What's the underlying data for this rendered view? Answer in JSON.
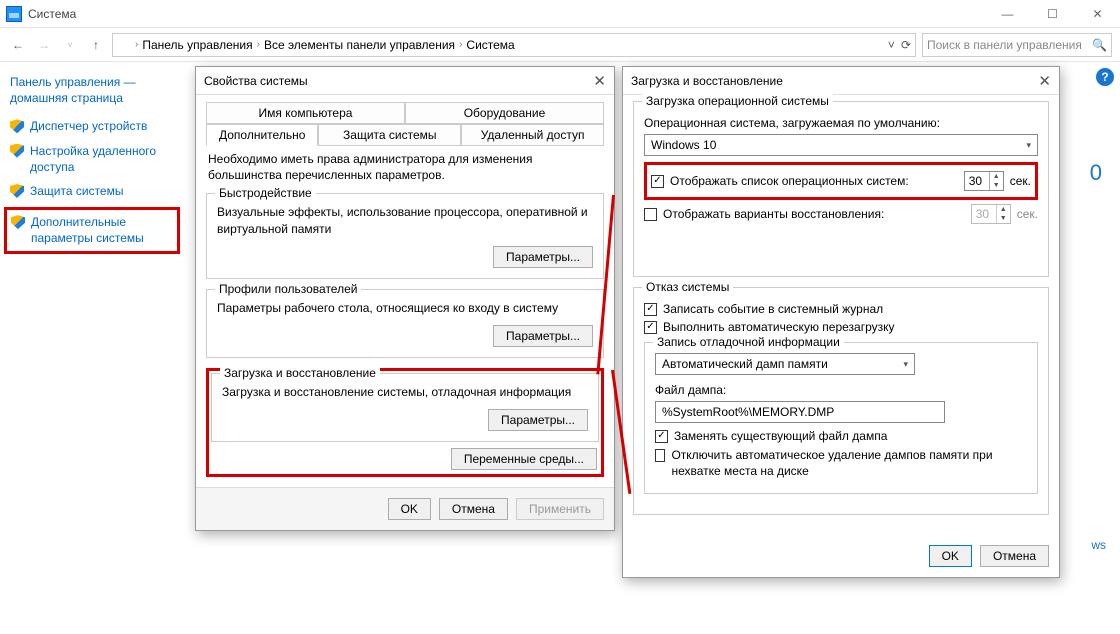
{
  "window": {
    "title": "Система",
    "minimize": "—",
    "maximize": "☐",
    "close": "✕"
  },
  "nav": {
    "back": "←",
    "forward": "→",
    "up": "↑",
    "dropdown": "˅",
    "refresh": "⟳"
  },
  "breadcrumb": {
    "seg1": "Панель управления",
    "seg2": "Все элементы панели управления",
    "seg3": "Система"
  },
  "search": {
    "placeholder": "Поиск в панели управления"
  },
  "sidebar": {
    "home": "Панель управления — домашняя страница",
    "items": [
      "Диспетчер устройств",
      "Настройка удаленного доступа",
      "Защита системы",
      "Дополнительные параметры системы"
    ]
  },
  "dialog1": {
    "title": "Свойства системы",
    "tabs_row1": [
      "Имя компьютера",
      "Оборудование"
    ],
    "tabs_row2": [
      "Дополнительно",
      "Защита системы",
      "Удаленный доступ"
    ],
    "note": "Необходимо иметь права администратора для изменения большинства перечисленных параметров.",
    "group1": {
      "legend": "Быстродействие",
      "text": "Визуальные эффекты, использование процессора, оперативной и виртуальной памяти",
      "btn": "Параметры..."
    },
    "group2": {
      "legend": "Профили пользователей",
      "text": "Параметры рабочего стола, относящиеся ко входу в систему",
      "btn": "Параметры..."
    },
    "group3": {
      "legend": "Загрузка и восстановление",
      "text": "Загрузка и восстановление системы, отладочная информация",
      "btn": "Параметры..."
    },
    "envbtn": "Переменные среды...",
    "ok": "OK",
    "cancel": "Отмена",
    "apply": "Применить"
  },
  "dialog2": {
    "title": "Загрузка и восстановление",
    "group_boot": {
      "legend": "Загрузка операционной системы",
      "os_label": "Операционная система, загружаемая по умолчанию:",
      "os_value": "Windows 10",
      "show_os_list": "Отображать список операционных систем:",
      "show_os_list_val": "30",
      "show_recovery": "Отображать варианты восстановления:",
      "show_recovery_val": "30",
      "sec": "сек."
    },
    "group_fail": {
      "legend": "Отказ системы",
      "write_log": "Записать событие в системный журнал",
      "auto_restart": "Выполнить автоматическую перезагрузку",
      "debug_legend": "Запись отладочной информации",
      "dump_type": "Автоматический дамп памяти",
      "dump_file_label": "Файл дампа:",
      "dump_file": "%SystemRoot%\\MEMORY.DMP",
      "replace": "Заменять существующий файл дампа",
      "disable_auto_delete": "Отключить автоматическое удаление дампов памяти при нехватке места на диске"
    },
    "ok": "OK",
    "cancel": "Отмена"
  },
  "remnants": {
    "zero": "0",
    "ws": "ws"
  }
}
